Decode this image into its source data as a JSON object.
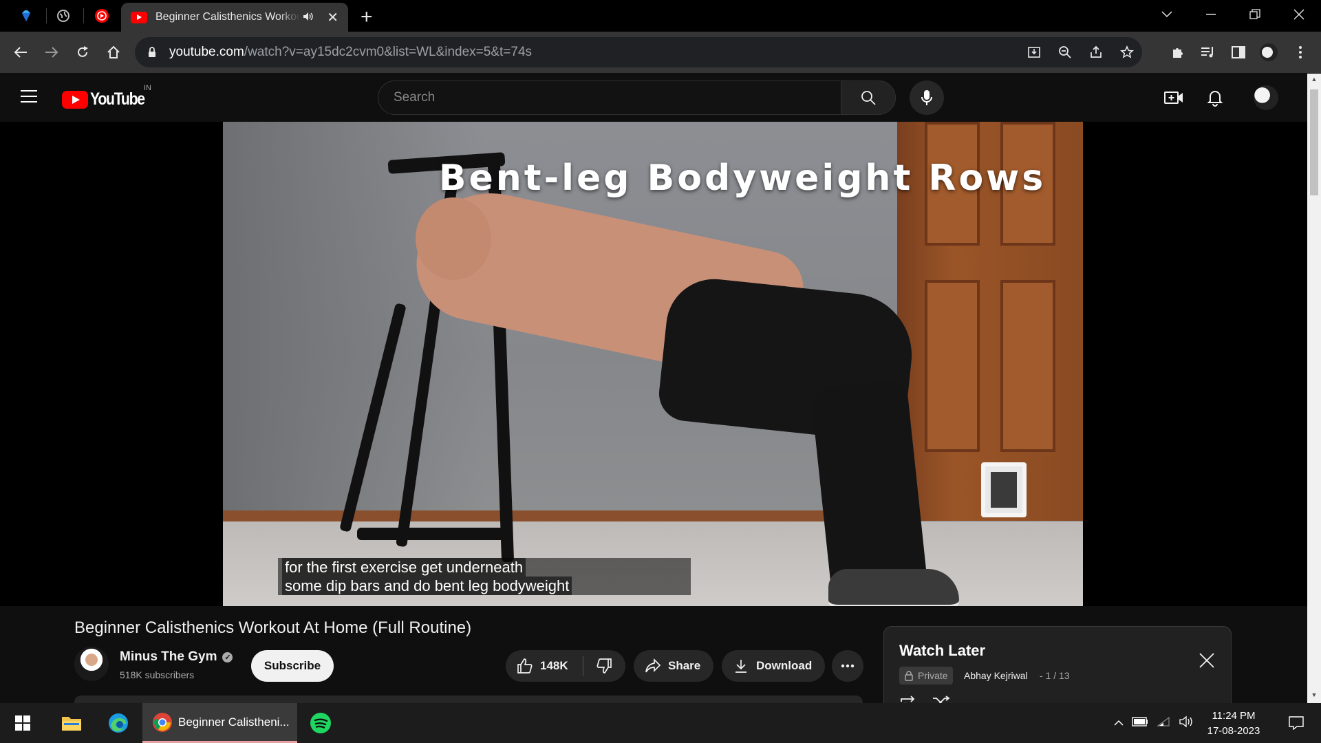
{
  "browser": {
    "active_tab_title": "Beginner Calisthenics Workout At Home (Full Routine)",
    "url_domain": "youtube.com",
    "url_path": "/watch?v=ay15dc2cvm0&list=WL&index=5&t=74s"
  },
  "masthead": {
    "logo_text": "YouTube",
    "country_code": "IN",
    "search_placeholder": "Search"
  },
  "video": {
    "overlay_title": "Bent-leg Bodyweight Rows",
    "captions": [
      "for the first exercise get underneath",
      "some dip bars and do bent leg bodyweight"
    ],
    "title": "Beginner Calisthenics Workout At Home (Full Routine)"
  },
  "channel": {
    "name": "Minus The Gym",
    "subscribers": "518K subscribers",
    "subscribe_label": "Subscribe"
  },
  "actions": {
    "like_count": "148K",
    "share_label": "Share",
    "download_label": "Download"
  },
  "playlist": {
    "title": "Watch Later",
    "privacy": "Private",
    "owner": "Abhay Kejriwal",
    "position": "- 1 / 13"
  },
  "taskbar": {
    "active_app_label": "Beginner Calistheni...",
    "time": "11:24 PM",
    "date": "17-08-2023"
  },
  "colors": {
    "youtube_red": "#ff0000",
    "browser_toolbar": "#353535",
    "page_background": "#0f0f0f"
  }
}
